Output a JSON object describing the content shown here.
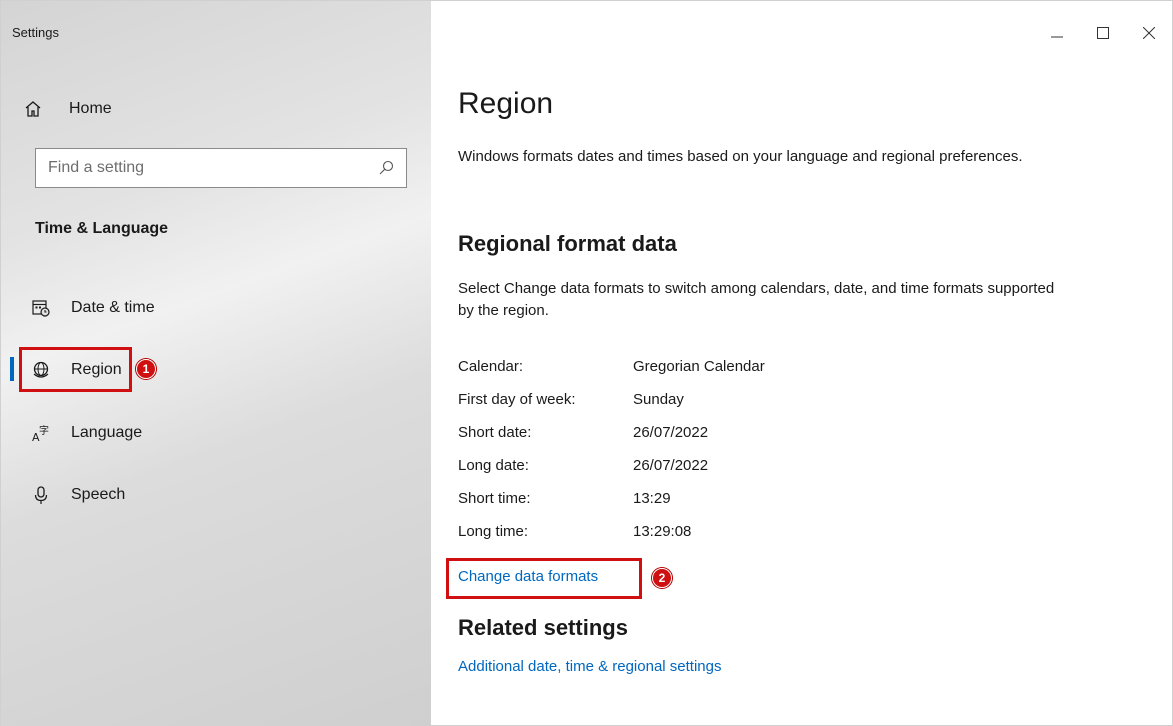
{
  "window": {
    "title": "Settings",
    "controls": {
      "minimize": "—",
      "maximize": "☐",
      "close": "✕"
    }
  },
  "sidebar": {
    "home_label": "Home",
    "search_placeholder": "Find a setting",
    "section_heading": "Time & Language",
    "items": [
      {
        "label": "Date & time",
        "icon": "calendar-clock-icon"
      },
      {
        "label": "Region",
        "icon": "globe-icon",
        "active": true
      },
      {
        "label": "Language",
        "icon": "language-icon"
      },
      {
        "label": "Speech",
        "icon": "microphone-icon"
      }
    ]
  },
  "main": {
    "title": "Region",
    "description": "Windows formats dates and times based on your language and regional preferences.",
    "regional_format": {
      "heading": "Regional format data",
      "description": "Select Change data formats to switch among calendars, date, and time formats supported by the region.",
      "rows": [
        {
          "key": "Calendar:",
          "value": "Gregorian Calendar"
        },
        {
          "key": "First day of week:",
          "value": "Sunday"
        },
        {
          "key": "Short date:",
          "value": "26/07/2022"
        },
        {
          "key": "Long date:",
          "value": "26/07/2022"
        },
        {
          "key": "Short time:",
          "value": "13:29"
        },
        {
          "key": "Long time:",
          "value": "13:29:08"
        }
      ],
      "change_link": "Change data formats"
    },
    "related": {
      "heading": "Related settings",
      "link": "Additional date, time & regional settings"
    }
  },
  "annotations": {
    "badge_1": "1",
    "badge_2": "2",
    "highlight_color": "#d01010"
  },
  "colors": {
    "accent": "#0067c0",
    "link": "#0067c0"
  }
}
